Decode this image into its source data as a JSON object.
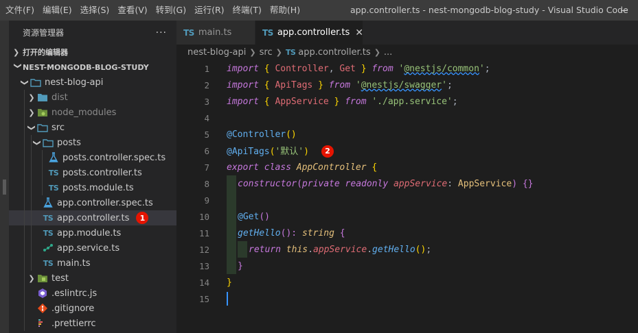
{
  "menus": [
    "文件(F)",
    "编辑(E)",
    "选择(S)",
    "查看(V)",
    "转到(G)",
    "运行(R)",
    "终端(T)",
    "帮助(H)"
  ],
  "window_title": "app.controller.ts - nest-mongodb-blog-study - Visual Studio Code",
  "sidebar": {
    "title": "资源管理器",
    "more": "···",
    "open_editors": "打开的编辑器",
    "workspace": "NEST-MONGODB-BLOG-STUDY",
    "tree": {
      "nest_blog_api": "nest-blog-api",
      "dist": "dist",
      "node_modules": "node_modules",
      "src": "src",
      "posts": "posts",
      "posts_controller_spec": "posts.controller.spec.ts",
      "posts_controller": "posts.controller.ts",
      "posts_module": "posts.module.ts",
      "app_controller_spec": "app.controller.spec.ts",
      "app_controller": "app.controller.ts",
      "app_module": "app.module.ts",
      "app_service": "app.service.ts",
      "main": "main.ts",
      "test": "test",
      "eslintrc": ".eslintrc.js",
      "gitignore": ".gitignore",
      "prettierrc": ".prettierrc"
    },
    "badge": "1"
  },
  "ts_label": "TS",
  "tabs": [
    {
      "label": "main.ts"
    },
    {
      "label": "app.controller.ts"
    }
  ],
  "tab_close": "✕",
  "breadcrumbs": [
    "nest-blog-api",
    "src",
    "app.controller.ts",
    "..."
  ],
  "line_numbers": [
    "1",
    "2",
    "3",
    "4",
    "5",
    "6",
    "7",
    "8",
    "9",
    "10",
    "11",
    "12",
    "13",
    "14",
    "15"
  ],
  "code": {
    "l1": [
      "import",
      " { ",
      "Controller",
      ", ",
      "Get",
      " } ",
      "from",
      " '",
      "@nestjs/common",
      "'",
      ";"
    ],
    "l2": [
      "import",
      " { ",
      "ApiTags",
      " } ",
      "from",
      " '",
      "@nestjs/swagger",
      "'",
      ";"
    ],
    "l3": [
      "import",
      " { ",
      "AppService",
      " } ",
      "from",
      " ",
      "'./app.service'",
      ";"
    ],
    "l5": [
      "@Controller",
      "()"
    ],
    "l6": [
      "@ApiTags",
      "(",
      "'默认'",
      ")"
    ],
    "l7": [
      "export class",
      " ",
      "AppController",
      " {"
    ],
    "l8": [
      "constructor",
      "(",
      "private readonly",
      " ",
      "appService",
      ": ",
      "AppService",
      ") ",
      "{}"
    ],
    "l10": [
      "@Get",
      "()"
    ],
    "l11": [
      "getHello",
      "(): ",
      "string",
      " {"
    ],
    "l12": [
      "return",
      " ",
      "this",
      ".",
      "appService",
      ".",
      "getHello",
      "()",
      ";"
    ],
    "l13": [
      "}"
    ],
    "l14": [
      "}"
    ]
  },
  "code_badge": "2",
  "colors": {
    "accent": "#3794ff",
    "badge": "#e51400",
    "ts": "#519aba"
  }
}
